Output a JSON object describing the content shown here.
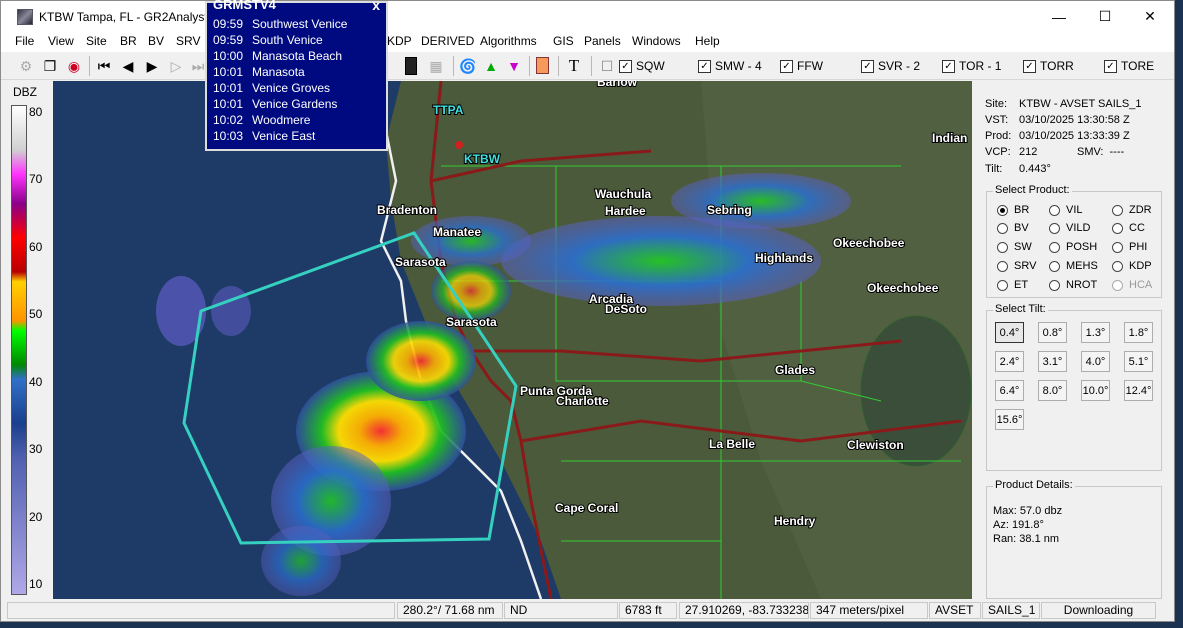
{
  "window": {
    "title": "KTBW Tampa, FL - GR2Analyst",
    "min_glyph": "—",
    "max_glyph": "☐",
    "close_glyph": "✕"
  },
  "menu": [
    "File",
    "View",
    "Site",
    "BR",
    "BV",
    "SRV",
    "KDP",
    "DERIVED",
    "Algorithms",
    "GIS",
    "Panels",
    "Windows",
    "Help"
  ],
  "toolbar": {
    "warnings": [
      {
        "label": "SQW",
        "checked": true
      },
      {
        "label": "SMW - 4",
        "checked": true
      },
      {
        "label": "FFW",
        "checked": true
      },
      {
        "label": "SVR - 2",
        "checked": true
      },
      {
        "label": "TOR - 1",
        "checked": true
      },
      {
        "label": "TORR",
        "checked": true
      },
      {
        "label": "TORE",
        "checked": true
      }
    ]
  },
  "colorbar": {
    "unit": "DBZ",
    "ticks": [
      "80",
      "70",
      "60",
      "50",
      "40",
      "30",
      "20",
      "10"
    ]
  },
  "popup": {
    "title": "GRMSTV4",
    "close": "x",
    "rows": [
      {
        "time": "09:59",
        "place": "Southwest Venice"
      },
      {
        "time": "09:59",
        "place": "South Venice"
      },
      {
        "time": "10:00",
        "place": "Manasota Beach"
      },
      {
        "time": "10:01",
        "place": "Manasota"
      },
      {
        "time": "10:01",
        "place": "Venice Groves"
      },
      {
        "time": "10:01",
        "place": "Venice Gardens"
      },
      {
        "time": "10:02",
        "place": "Woodmere"
      },
      {
        "time": "10:03",
        "place": "Venice East"
      }
    ]
  },
  "map": {
    "cities": [
      "Barlow",
      "TTPA",
      "KTBW",
      "Wauchula",
      "Hardee",
      "Sebring",
      "Indian",
      "Bradenton",
      "Manatee",
      "Highlands",
      "Okeechobee",
      "Okeechobee",
      "Sarasota",
      "Arcadia",
      "DeSoto",
      "Sarasota",
      "Glades",
      "Punta Gorda",
      "Charlotte",
      "La Belle",
      "Clewiston",
      "Cape Coral",
      "Hendry"
    ]
  },
  "info": {
    "site_label": "Site:",
    "site": "KTBW - AVSET SAILS_1",
    "vst_label": "VST:",
    "vst": "03/10/2025  13:30:58 Z",
    "prod_label": "Prod:",
    "prod": "03/10/2025  13:33:39 Z",
    "vcp_label": "VCP:",
    "vcp": "212",
    "smv_label": "SMV:",
    "smv": "----",
    "tilt_label": "Tilt:",
    "tilt": "0.443°"
  },
  "select_product": {
    "title": "Select Product:",
    "items": [
      {
        "label": "BR",
        "on": true,
        "disabled": false
      },
      {
        "label": "VIL",
        "on": false,
        "disabled": false
      },
      {
        "label": "ZDR",
        "on": false,
        "disabled": false
      },
      {
        "label": "BV",
        "on": false,
        "disabled": false
      },
      {
        "label": "VILD",
        "on": false,
        "disabled": false
      },
      {
        "label": "CC",
        "on": false,
        "disabled": false
      },
      {
        "label": "SW",
        "on": false,
        "disabled": false
      },
      {
        "label": "POSH",
        "on": false,
        "disabled": false
      },
      {
        "label": "PHI",
        "on": false,
        "disabled": false
      },
      {
        "label": "SRV",
        "on": false,
        "disabled": false
      },
      {
        "label": "MEHS",
        "on": false,
        "disabled": false
      },
      {
        "label": "KDP",
        "on": false,
        "disabled": false
      },
      {
        "label": "ET",
        "on": false,
        "disabled": false
      },
      {
        "label": "NROT",
        "on": false,
        "disabled": false
      },
      {
        "label": "HCA",
        "on": false,
        "disabled": true
      }
    ]
  },
  "select_tilt": {
    "title": "Select Tilt:",
    "items": [
      "0.4°",
      "0.8°",
      "1.3°",
      "1.8°",
      "2.4°",
      "3.1°",
      "4.0°",
      "5.1°",
      "6.4°",
      "8.0°",
      "10.0°",
      "12.4°",
      "15.6°"
    ],
    "selected": "0.4°"
  },
  "product_details": {
    "title": "Product Details:",
    "max": "Max:  57.0 dbz",
    "az": "Az:   191.8°",
    "ran": "Ran:  38.1 nm"
  },
  "status": {
    "azran": "280.2°/ 71.68 nm",
    "nd": "ND",
    "height": "6783 ft",
    "latlon": "27.910269, -83.733238",
    "scale": "347 meters/pixel",
    "mode": "AVSET",
    "sails": "SAILS_1",
    "state": "Downloading"
  }
}
